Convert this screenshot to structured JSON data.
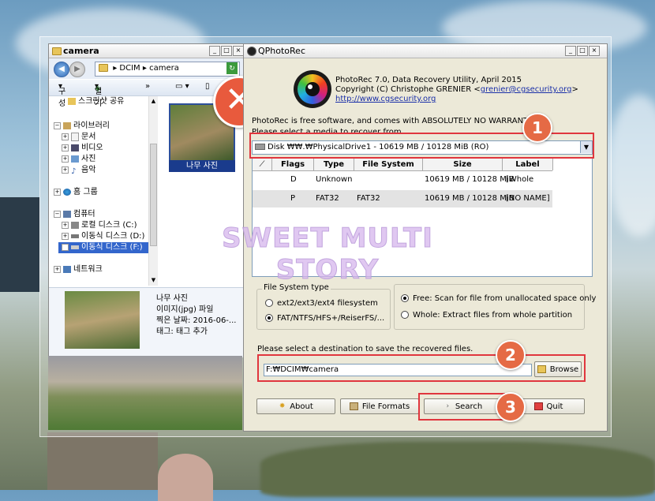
{
  "explorer": {
    "title": "camera",
    "address_root": "DCIM",
    "address_folder": "camera",
    "cmd_organize": "구성",
    "cmd_open": "열기",
    "cmd_more": "»",
    "tree": [
      {
        "label": "스크린샷 공유"
      },
      {
        "label": "라이브러리"
      },
      {
        "label": "문서"
      },
      {
        "label": "비디오"
      },
      {
        "label": "사진"
      },
      {
        "label": "음악"
      },
      {
        "label": "홈 그룹"
      },
      {
        "label": "컴퓨터"
      },
      {
        "label": "로컬 디스크 (C:)"
      },
      {
        "label": "이동식 디스크 (D:)"
      },
      {
        "label": "이동식 디스크 (F:)"
      },
      {
        "label": "네트워크"
      }
    ],
    "file_name": "나무 사진",
    "details": {
      "name": "나무 사진",
      "type": "이미지(jpg) 파일",
      "date": "찍은 날짜: 2016-06-...",
      "tags": "태그: 태그 추가"
    }
  },
  "photorec": {
    "title": "QPhotoRec",
    "header_line1": "PhotoRec 7.0, Data Recovery Utility, April 2015",
    "header_line2_prefix": "Copyright (C) Christophe GRENIER <",
    "header_email": "grenier@cgsecurity.org",
    "header_line2_suffix": ">",
    "header_url": "http://www.cgsecurity.org",
    "free_notice": "PhotoRec is free software, and comes with ABSOLUTELY NO WARRANTY.",
    "select_media": "Please select a media to recover from",
    "media_selected": "Disk ₩₩.₩PhysicalDrive1 - 10619 MB / 10128 MiB (RO)",
    "table": {
      "headers": [
        "Flags",
        "Type",
        "File System",
        "Size",
        "Label"
      ],
      "rows": [
        {
          "flags": "D",
          "type": "Unknown",
          "fs": "",
          "size": "10619 MB / 10128 MiB",
          "label": "[Whole disk]"
        },
        {
          "flags": "P",
          "type": "FAT32",
          "fs": "FAT32",
          "size": "10619 MB / 10128 MiB",
          "label": "[NO NAME]"
        }
      ]
    },
    "fs_group_label": "File System type",
    "fs_option_1": "ext2/ext3/ext4 filesystem",
    "fs_option_2": "FAT/NTFS/HFS+/ReiserFS/...",
    "scan_option_1": "Free: Scan for file from unallocated space only",
    "scan_option_2": "Whole: Extract files from whole partition",
    "dest_prompt": "Please select a destination to save the recovered files.",
    "dest_value": "F:₩DCIM₩camera",
    "buttons": {
      "browse": "Browse",
      "about": "About",
      "file_formats": "File Formats",
      "search": "Search",
      "quit": "Quit"
    }
  },
  "annotations": {
    "step1": "1",
    "step2": "2",
    "step3": "3",
    "watermark": "SWEET MULTI STORY"
  },
  "colors": {
    "highlight": "#e0363e",
    "step_badge": "#e56a45",
    "selection": "#3366cc"
  }
}
